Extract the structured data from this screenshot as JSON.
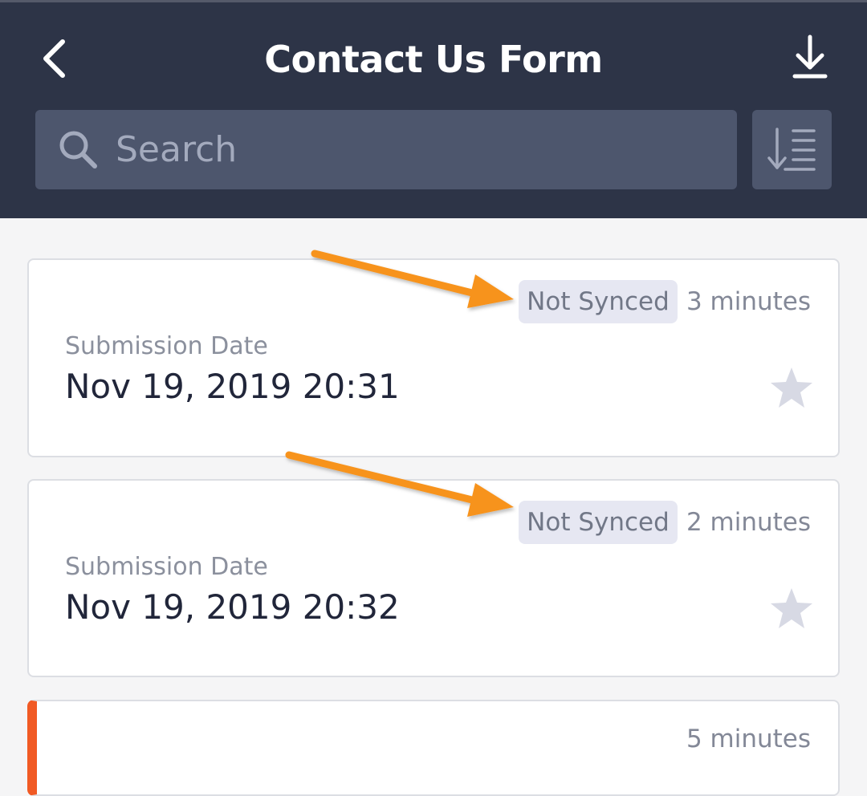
{
  "header": {
    "title": "Contact Us Form",
    "back_icon": "chevron-left-icon",
    "download_icon": "download-icon"
  },
  "search": {
    "placeholder": "Search",
    "value": "",
    "icon": "search-icon"
  },
  "sort": {
    "icon": "sort-list-icon"
  },
  "submissions": [
    {
      "badge": "Not Synced",
      "time": "3 minutes",
      "label": "Submission Date",
      "value": "Nov 19, 2019 20:31",
      "starred": false
    },
    {
      "badge": "Not Synced",
      "time": "2 minutes",
      "label": "Submission Date",
      "value": "Nov 19, 2019 20:32",
      "starred": false
    },
    {
      "time": "5 minutes"
    }
  ],
  "colors": {
    "header_bg": "#2d3447",
    "search_bg": "#4d566d",
    "accent_arrow": "#f7931e",
    "accent_stripe": "#f15a24",
    "badge_bg": "#e6e7f2"
  }
}
